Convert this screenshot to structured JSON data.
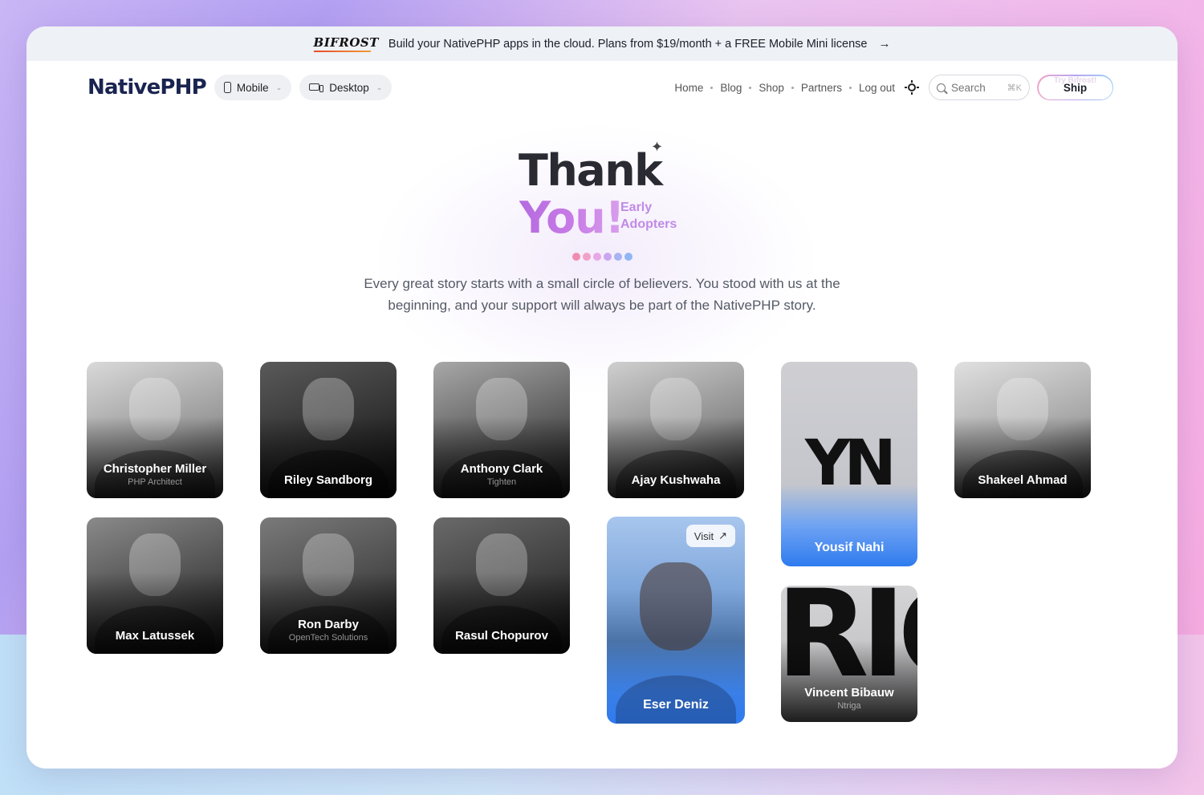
{
  "banner": {
    "brand": "BIFROST",
    "text": "Build your NativePHP apps in the cloud. Plans from $19/month + a FREE Mobile Mini license",
    "arrow": "→"
  },
  "nav": {
    "logo": "NativePHP",
    "pills": [
      {
        "label": "Mobile"
      },
      {
        "label": "Desktop"
      }
    ],
    "links": [
      "Home",
      "Blog",
      "Shop",
      "Partners",
      "Log out"
    ],
    "search": {
      "placeholder": "Search",
      "shortcut": "⌘K"
    },
    "cta": {
      "label": "Ship",
      "ghost": "Try Bifrost!"
    }
  },
  "hero": {
    "line1": "Thank",
    "line2": "You!",
    "sub1": "Early",
    "sub2": "Adopters",
    "sparkle": "✦",
    "dots": [
      "#f08bb0",
      "#f3a0c8",
      "#e9a6e6",
      "#c9a6ef",
      "#a8b3f2",
      "#8fb6f4"
    ],
    "lede": "Every great story starts with a small circle of believers. You stood with us at the beginning, and your support will always be part of the NativePHP story."
  },
  "cards": [
    {
      "name": "Christopher Miller",
      "role": "PHP Architect"
    },
    {
      "name": "Riley Sandborg",
      "role": ""
    },
    {
      "name": "Anthony Clark",
      "role": "Tighten"
    },
    {
      "name": "Ajay Kushwaha",
      "role": ""
    },
    {
      "name": "Yousif Nahi",
      "role": "",
      "logo": "YN"
    },
    {
      "name": "Shakeel Ahmad",
      "role": ""
    },
    {
      "name": "Max Latussek",
      "role": ""
    },
    {
      "name": "Ron Darby",
      "role": "OpenTech Solutions"
    },
    {
      "name": "Rasul Chopurov",
      "role": ""
    },
    {
      "name": "Eser Deniz",
      "role": "",
      "visit": "Visit",
      "visit_icon": "↗"
    },
    {
      "name": "Vincent Bibauw",
      "role": "Ntriga",
      "logo": "RIC"
    }
  ],
  "colors": {
    "accent_purple": "#c08ae6",
    "featured_blue": "#2f7bef"
  }
}
